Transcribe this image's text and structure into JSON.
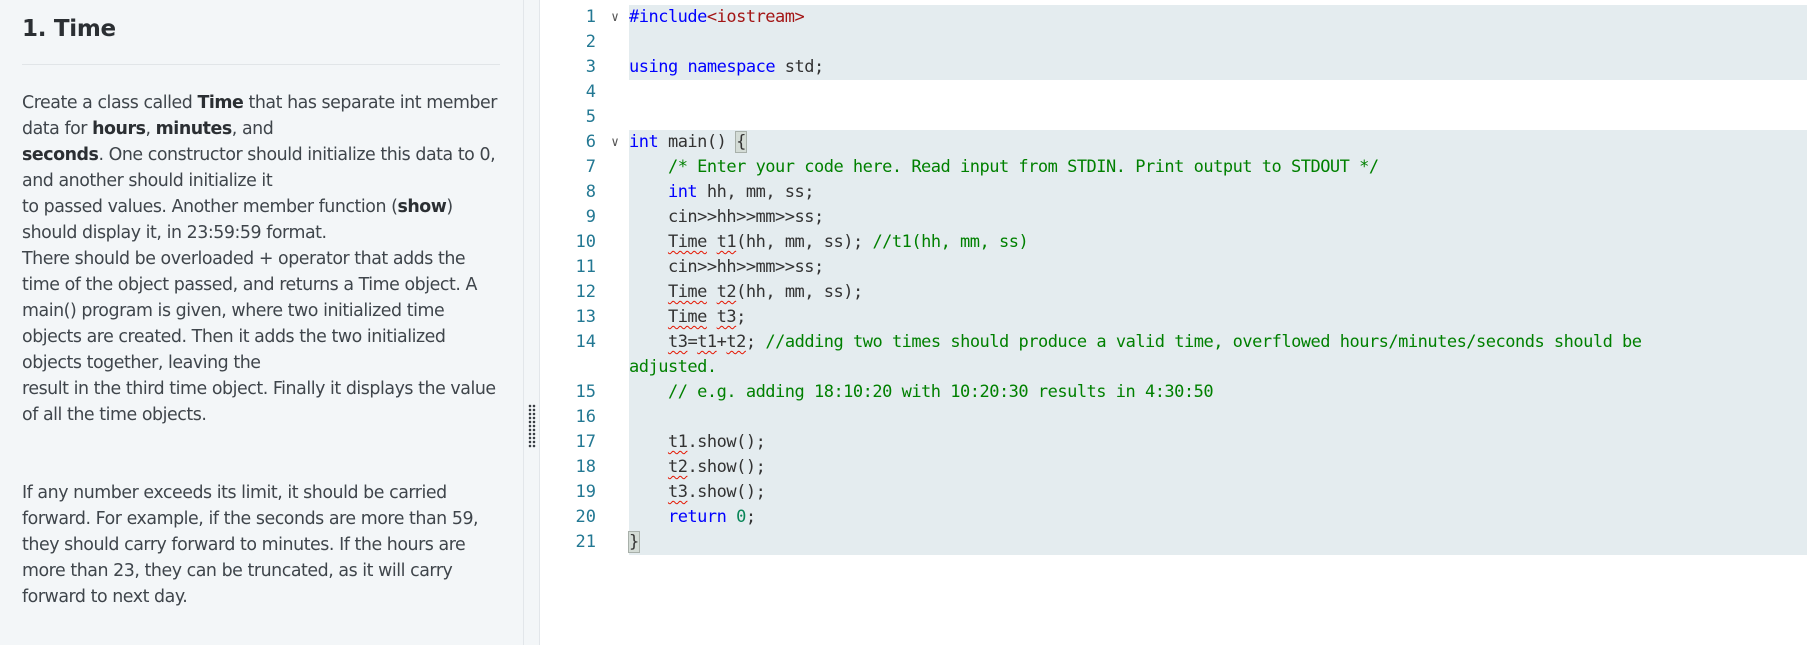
{
  "problem": {
    "title": "1. Time",
    "paragraph1": [
      {
        "text": "Create a class called ",
        "bold": false
      },
      {
        "text": "Time",
        "bold": true
      },
      {
        "text": " that has separate int member data for ",
        "bold": false
      },
      {
        "text": "hours",
        "bold": true
      },
      {
        "text": ", ",
        "bold": false
      },
      {
        "text": "minutes",
        "bold": true
      },
      {
        "text": ", and",
        "bold": false
      },
      {
        "text": "seconds",
        "bold": true
      },
      {
        "text": ". One constructor should initialize this data to 0, and another should initialize it",
        "bold": false
      },
      {
        "text": "to passed values. Another member function (",
        "bold": false
      },
      {
        "text": "show",
        "bold": true
      },
      {
        "text": ") should display it, in 23:59:59 format.",
        "bold": false
      },
      {
        "text": "There should be overloaded + operator that adds the time of the object passed, and returns a Time object. A main() program is given, where two initialized time objects are created. Then it adds the two initialized objects together, leaving the",
        "bold": false
      },
      {
        "text": "result in the third time object. Finally it displays the value of all the time objects.",
        "bold": false
      }
    ],
    "paragraph2": "If any number exceeds its limit, it should be carried forward. For example, if the seconds are more than 59, they should carry forward to minutes. If the hours are more than 23, they can be truncated, as it will carry forward to next day."
  },
  "editor": {
    "lines": [
      {
        "n": "1",
        "fold": true,
        "tokens": [
          [
            "pp",
            "#include"
          ],
          [
            "str",
            "<iostream>"
          ]
        ]
      },
      {
        "n": "2",
        "tokens": []
      },
      {
        "n": "3",
        "tokens": [
          [
            "kw",
            "using"
          ],
          [
            "",
            " "
          ],
          [
            "kw",
            "namespace"
          ],
          [
            "",
            " std;"
          ]
        ]
      },
      {
        "n": "4",
        "tokens": []
      },
      {
        "n": "5",
        "tokens": []
      },
      {
        "n": "6",
        "fold": true,
        "tokens": [
          [
            "kw",
            "int"
          ],
          [
            "",
            " main() "
          ],
          [
            "brace",
            "{"
          ]
        ]
      },
      {
        "n": "7",
        "tokens": [
          [
            "",
            "    "
          ],
          [
            "cm",
            "/* Enter your code here. Read input from STDIN. Print output to STDOUT */"
          ]
        ]
      },
      {
        "n": "8",
        "tokens": [
          [
            "",
            "    "
          ],
          [
            "kw",
            "int"
          ],
          [
            "",
            " hh, mm, ss;"
          ]
        ]
      },
      {
        "n": "9",
        "tokens": [
          [
            "",
            "    cin>>hh>>mm>>ss;"
          ]
        ]
      },
      {
        "n": "10",
        "tokens": [
          [
            "",
            "    "
          ],
          [
            "sq",
            "Time"
          ],
          [
            "",
            " "
          ],
          [
            "sq",
            "t1"
          ],
          [
            "",
            "(hh, mm, ss); "
          ],
          [
            "cm",
            "//t1(hh, mm, ss)"
          ]
        ]
      },
      {
        "n": "11",
        "tokens": [
          [
            "",
            "    cin>>hh>>mm>>ss;"
          ]
        ]
      },
      {
        "n": "12",
        "tokens": [
          [
            "",
            "    "
          ],
          [
            "sq",
            "Time"
          ],
          [
            "",
            " "
          ],
          [
            "sq",
            "t2"
          ],
          [
            "",
            "(hh, mm, ss);"
          ]
        ]
      },
      {
        "n": "13",
        "tokens": [
          [
            "",
            "    "
          ],
          [
            "sq",
            "Time"
          ],
          [
            "",
            " "
          ],
          [
            "sq",
            "t3"
          ],
          [
            "",
            ";"
          ]
        ]
      },
      {
        "n": "14",
        "tokens": [
          [
            "",
            "    "
          ],
          [
            "sq",
            "t3"
          ],
          [
            "",
            "="
          ],
          [
            "sq",
            "t1"
          ],
          [
            "",
            "+"
          ],
          [
            "sq",
            "t2"
          ],
          [
            "",
            "; "
          ],
          [
            "cm",
            "//adding two times should produce a valid time, overflowed hours/minutes/seconds should be"
          ]
        ]
      },
      {
        "n": "",
        "tokens": [
          [
            "cm",
            "adjusted."
          ]
        ]
      },
      {
        "n": "15",
        "tokens": [
          [
            "",
            "    "
          ],
          [
            "cm",
            "// e.g. adding 18:10:20 with 10:20:30 results in 4:30:50"
          ]
        ]
      },
      {
        "n": "16",
        "tokens": []
      },
      {
        "n": "17",
        "tokens": [
          [
            "",
            "    "
          ],
          [
            "sq",
            "t1"
          ],
          [
            "",
            ".show();"
          ]
        ]
      },
      {
        "n": "18",
        "tokens": [
          [
            "",
            "    "
          ],
          [
            "sq",
            "t2"
          ],
          [
            "",
            ".show();"
          ]
        ]
      },
      {
        "n": "19",
        "tokens": [
          [
            "",
            "    "
          ],
          [
            "sq",
            "t3"
          ],
          [
            "",
            ".show();"
          ]
        ]
      },
      {
        "n": "20",
        "tokens": [
          [
            "",
            "    "
          ],
          [
            "kw",
            "return"
          ],
          [
            "",
            " "
          ],
          [
            "num",
            "0"
          ],
          [
            "",
            ";"
          ]
        ]
      },
      {
        "n": "21",
        "tokens": [
          [
            "brace",
            "}"
          ]
        ]
      }
    ]
  }
}
